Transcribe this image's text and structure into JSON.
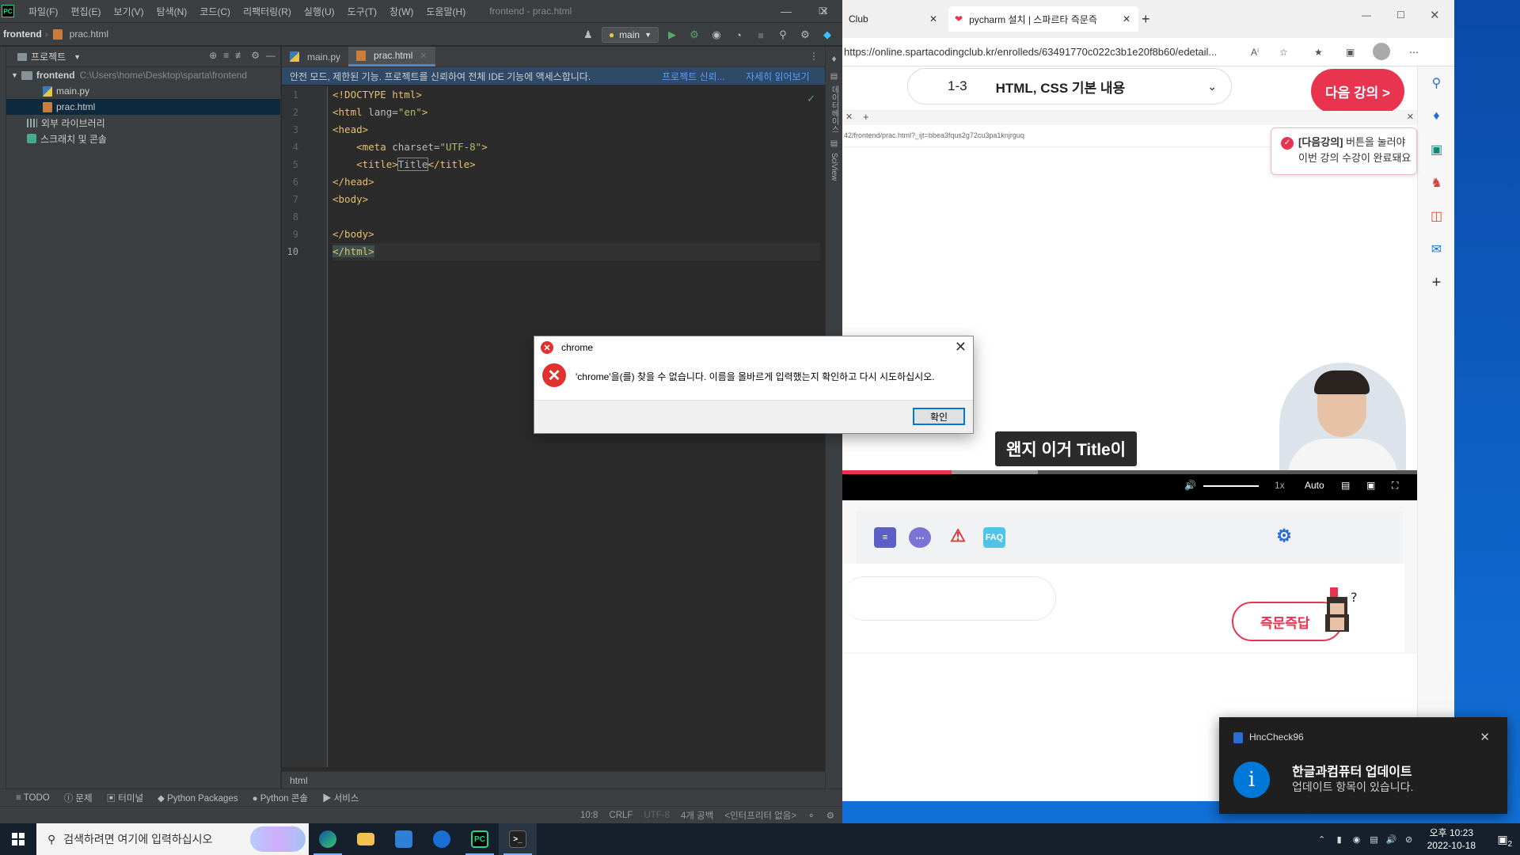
{
  "pycharm": {
    "logo": "PC",
    "menu": [
      "파일(F)",
      "편집(E)",
      "보기(V)",
      "탐색(N)",
      "코드(C)",
      "리팩터링(R)",
      "실행(U)",
      "도구(T)",
      "창(W)",
      "도움말(H)"
    ],
    "title": "frontend - prac.html",
    "nav_project": "frontend",
    "nav_file": "prac.html",
    "run_config": "main",
    "project_panel": {
      "header": "프로젝트",
      "root_name": "frontend",
      "root_path": "C:\\Users\\home\\Desktop\\sparta\\frontend",
      "files": [
        "main.py",
        "prac.html"
      ],
      "external_libs": "외부 라이브러리",
      "scratches": "스크래치 및 콘솔"
    },
    "tabs": [
      {
        "label": "main.py"
      },
      {
        "label": "prac.html"
      }
    ],
    "safe_mode_banner": {
      "text": "안전 모드, 제한된 기능. 프로젝트를 신뢰하여 전체 IDE 기능에 액세스합니다.",
      "trust_link": "프로젝트 신뢰...",
      "more_link": "자세히 읽어보기"
    },
    "line_numbers": [
      "1",
      "2",
      "3",
      "4",
      "5",
      "6",
      "7",
      "8",
      "9",
      "10"
    ],
    "code_breadcrumb": "html",
    "right_tabs": [
      "데이터베이스",
      "SciView"
    ],
    "tool_windows": [
      "TODO",
      "문제",
      "터미널",
      "Python Packages",
      "Python 콘솔",
      "서비스"
    ],
    "status": {
      "position": "10:8",
      "line_sep": "CRLF",
      "encoding": "UTF-8",
      "indent": "4개 공백",
      "interpreter": "<인터프리터 없음>"
    }
  },
  "browser": {
    "tab1_title": "Club",
    "tab2_title": "pycharm 설치 | 스파르타 즉문즉",
    "url": "https://online.spartacodingclub.kr/enrolleds/63491770c022c3b1e20f8b60/edetail...",
    "lecture_number": "1-3",
    "lecture_title": "HTML, CSS 기본 내용",
    "next_button": "다음 강의 >",
    "mini_url": "42/frontend/prac.html?_ijt=bbea3fqus2g72cu3pa1knjrguq",
    "tip_line1_bold": "[다음강의]",
    "tip_line1_rest": " 버튼을 눌러야",
    "tip_line2": "이번 강의 수강이 완료돼요",
    "subtitle": "왠지 이거 Title이",
    "video_progress": 0.19,
    "video_buffered": 0.34,
    "video_speed": "1x",
    "video_quality": "Auto",
    "tool_faq": "FAQ",
    "qa_button": "즉문즉답"
  },
  "dialog": {
    "title": "chrome",
    "message": "'chrome'을(를) 찾을 수 없습니다. 이름을 올바르게 입력했는지 확인하고 다시 시도하십시오.",
    "ok": "확인"
  },
  "toast": {
    "app": "HncCheck96",
    "title": "한글과컴퓨터 업데이트",
    "body": "업데이트 항목이 있습니다."
  },
  "taskbar": {
    "search_placeholder": "검색하려면 여기에 입력하십시오",
    "time": "오후 10:23",
    "date": "2022-10-18",
    "notification_count": "2"
  }
}
